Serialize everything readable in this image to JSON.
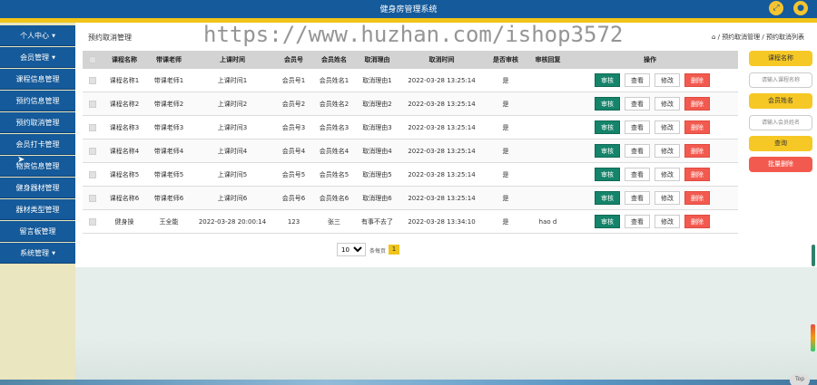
{
  "header": {
    "title": "健身房管理系统",
    "fullscreen_icon": "expand-icon",
    "user_icon": "user-icon"
  },
  "sidebar": {
    "items": [
      {
        "label": "个人中心",
        "caret": true
      },
      {
        "label": "会员管理",
        "caret": true
      },
      {
        "label": "课程信息管理",
        "caret": false
      },
      {
        "label": "预约信息管理",
        "caret": false
      },
      {
        "label": "预约取消管理",
        "caret": false
      },
      {
        "label": "会员打卡管理",
        "caret": false
      },
      {
        "label": "物资信息管理",
        "caret": false
      },
      {
        "label": "健身器材管理",
        "caret": false
      },
      {
        "label": "器材类型管理",
        "caret": false
      },
      {
        "label": "留言板管理",
        "caret": false
      },
      {
        "label": "系统管理",
        "caret": true
      }
    ]
  },
  "page": {
    "title": "预约取消管理",
    "breadcrumb": [
      "预约取消管理",
      "预约取消列表"
    ],
    "watermark": "https://www.huzhan.com/ishop3572"
  },
  "table": {
    "headers": [
      "课程名称",
      "带课老师",
      "上课时间",
      "会员号",
      "会员姓名",
      "取消理由",
      "取消时间",
      "是否审核",
      "审核回复",
      "操作"
    ],
    "actions": {
      "audit": "审核",
      "view": "查看",
      "edit": "修改",
      "delete": "删除"
    },
    "rows": [
      [
        "课程名称1",
        "带课老师1",
        "上课时间1",
        "会员号1",
        "会员姓名1",
        "取消理由1",
        "2022-03-28 13:25:14",
        "是",
        ""
      ],
      [
        "课程名称2",
        "带课老师2",
        "上课时间2",
        "会员号2",
        "会员姓名2",
        "取消理由2",
        "2022-03-28 13:25:14",
        "是",
        ""
      ],
      [
        "课程名称3",
        "带课老师3",
        "上课时间3",
        "会员号3",
        "会员姓名3",
        "取消理由3",
        "2022-03-28 13:25:14",
        "是",
        ""
      ],
      [
        "课程名称4",
        "带课老师4",
        "上课时间4",
        "会员号4",
        "会员姓名4",
        "取消理由4",
        "2022-03-28 13:25:14",
        "是",
        ""
      ],
      [
        "课程名称5",
        "带课老师5",
        "上课时间5",
        "会员号5",
        "会员姓名5",
        "取消理由5",
        "2022-03-28 13:25:14",
        "是",
        ""
      ],
      [
        "课程名称6",
        "带课老师6",
        "上课时间6",
        "会员号6",
        "会员姓名6",
        "取消理由6",
        "2022-03-28 13:25:14",
        "是",
        ""
      ],
      [
        "健身操",
        "王全能",
        "2022-03-28 20:00:14",
        "123",
        "张三",
        "有事不去了",
        "2022-03-28 13:34:10",
        "是",
        "hao d"
      ]
    ]
  },
  "pagination": {
    "page_size": "10",
    "per_page_label": "条每页",
    "current_page": "1"
  },
  "search_panel": {
    "course_label": "课程名称",
    "course_placeholder": "请输入课程名称",
    "member_label": "会员姓名",
    "member_placeholder": "请输入会员姓名",
    "query_button": "查询",
    "batch_delete_button": "批量删除"
  },
  "back_to_top": "Top",
  "colors": {
    "primary": "#155a9a",
    "accent": "#f0c419",
    "audit_button": "#15846a",
    "delete_button": "#f25a4f"
  }
}
